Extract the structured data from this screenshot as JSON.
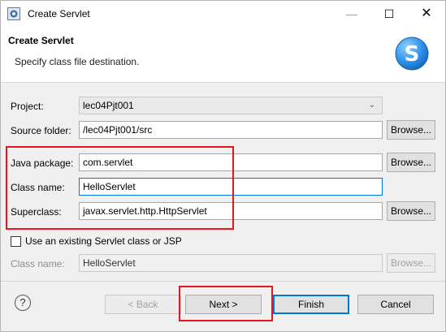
{
  "window": {
    "title": "Create Servlet",
    "controls": {
      "minimize": "—",
      "maximize": "☐",
      "close": "✕"
    }
  },
  "header": {
    "title": "Create Servlet",
    "subtitle": "Specify class file destination.",
    "logo_letter": "S"
  },
  "form": {
    "project": {
      "label": "Project:",
      "value": "lec04Pjt001"
    },
    "source_folder": {
      "label": "Source folder:",
      "value": "/lec04Pjt001/src",
      "browse": "Browse..."
    },
    "java_package": {
      "label": "Java package:",
      "value": "com.servlet",
      "browse": "Browse..."
    },
    "class_name": {
      "label": "Class name:",
      "value": "HelloServlet"
    },
    "superclass": {
      "label": "Superclass:",
      "value": "javax.servlet.http.HttpServlet",
      "browse": "Browse..."
    },
    "use_existing": {
      "label": "Use an existing Servlet class or JSP",
      "checked": false
    },
    "existing_class_name": {
      "label": "Class name:",
      "value": "HelloServlet",
      "browse": "Browse..."
    }
  },
  "footer": {
    "help": "?",
    "back": "< Back",
    "next": "Next >",
    "finish": "Finish",
    "cancel": "Cancel"
  },
  "colors": {
    "highlight": "#e8141e",
    "focus": "#0078d7",
    "logo": "#2b8fe8"
  }
}
